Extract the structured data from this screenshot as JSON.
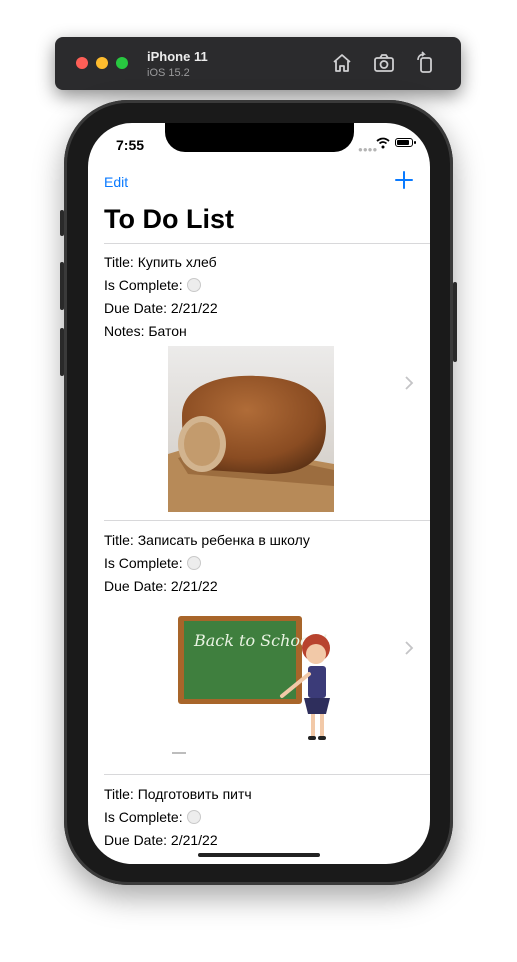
{
  "simulator": {
    "device_name": "iPhone 11",
    "os_version": "iOS 15.2",
    "buttons": [
      "home-icon",
      "screenshot-icon",
      "rotate-icon"
    ]
  },
  "status_bar": {
    "time": "7:55"
  },
  "nav": {
    "edit_label": "Edit",
    "add_icon": "plus-icon",
    "title": "To Do List"
  },
  "items": [
    {
      "title_line": "Title: Купить хлеб",
      "complete_label": "Is Complete:",
      "due_line": "Due Date: 2/21/22",
      "notes_line": "Notes: Батон",
      "image": "bread-photo"
    },
    {
      "title_line": "Title: Записать ребенка в школу",
      "complete_label": "Is Complete:",
      "due_line": "Due Date: 2/21/22",
      "image": "back-to-school-illustration",
      "image_text": "Back to School!!"
    },
    {
      "title_line": "Title: Подготовить питч",
      "complete_label": "Is Complete:",
      "due_line": "Due Date: 2/21/22"
    }
  ],
  "colors": {
    "accent": "#0a7aff",
    "separator": "#d8d8da"
  }
}
